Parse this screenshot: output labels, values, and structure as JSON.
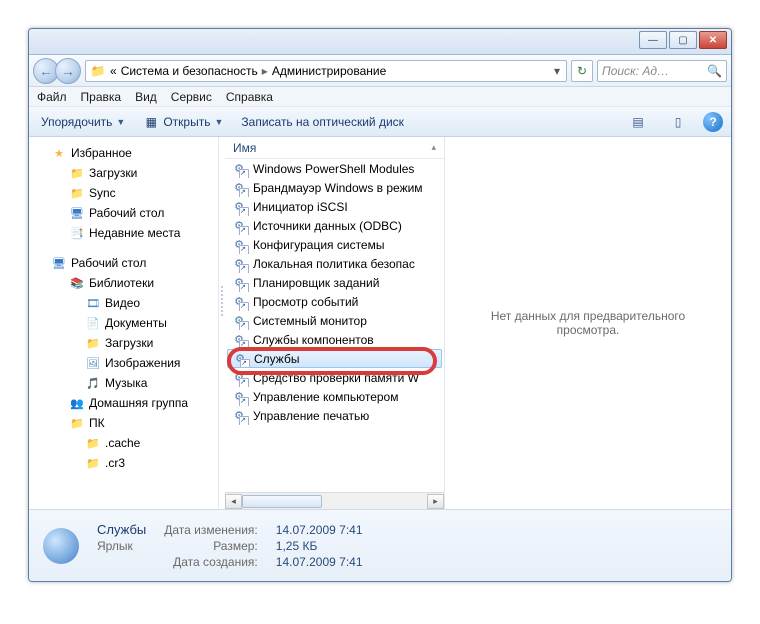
{
  "titlebar": {
    "min": "—",
    "max": "▢",
    "close": "✕"
  },
  "nav": {
    "back": "←",
    "forward": "→",
    "crumb_prefix": "«",
    "crumb1": "Система и безопасность",
    "crumb2": "Администрирование",
    "refresh": "↻",
    "search_placeholder": "Поиск: Ад…"
  },
  "menu": {
    "file": "Файл",
    "edit": "Правка",
    "view": "Вид",
    "service": "Сервис",
    "help": "Справка"
  },
  "toolbar": {
    "organize": "Упорядочить",
    "open": "Открыть",
    "burn": "Записать на оптический диск",
    "views_icon": "▤",
    "preview_icon": "▯",
    "help_icon": "?"
  },
  "sidebar": {
    "favorites": "Избранное",
    "fav_items": [
      {
        "icon": "folder",
        "label": "Загрузки"
      },
      {
        "icon": "folder",
        "label": "Sync"
      },
      {
        "icon": "desktop",
        "label": "Рабочий стол"
      },
      {
        "icon": "recent",
        "label": "Недавние места"
      }
    ],
    "desktop": "Рабочий стол",
    "libraries": "Библиотеки",
    "lib_items": [
      {
        "icon": "video",
        "label": "Видео"
      },
      {
        "icon": "doc",
        "label": "Документы"
      },
      {
        "icon": "folder",
        "label": "Загрузки"
      },
      {
        "icon": "img",
        "label": "Изображения"
      },
      {
        "icon": "music",
        "label": "Музыка"
      }
    ],
    "homegroup": "Домашняя группа",
    "pc": "ПК",
    "pc_items": [
      {
        "label": ".cache"
      },
      {
        "label": ".cr3"
      }
    ]
  },
  "files": {
    "col_name": "Имя",
    "items": [
      "Windows PowerShell Modules",
      "Брандмауэр Windows в режим",
      "Инициатор iSCSI",
      "Источники данных (ODBC)",
      "Конфигурация системы",
      "Локальная политика безопас",
      "Планировщик заданий",
      "Просмотр событий",
      "Системный монитор",
      "Службы компонентов",
      "Службы",
      "Средство проверки памяти W",
      "Управление компьютером",
      "Управление печатью"
    ],
    "selected_index": 10
  },
  "preview": {
    "empty": "Нет данных для предварительного просмотра."
  },
  "details": {
    "name": "Службы",
    "type": "Ярлык",
    "mod_label": "Дата изменения:",
    "mod_value": "14.07.2009 7:41",
    "size_label": "Размер:",
    "size_value": "1,25 КБ",
    "created_label": "Дата создания:",
    "created_value": "14.07.2009 7:41"
  }
}
